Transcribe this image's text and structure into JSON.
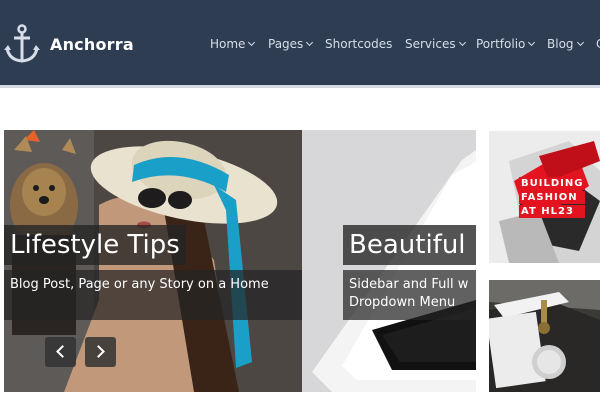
{
  "header": {
    "brand": "Anchorra",
    "logo_icon": "anchor-icon",
    "bg_color": "#2e3d52"
  },
  "nav": {
    "items": [
      {
        "label": "Home",
        "has_dropdown": true
      },
      {
        "label": "Pages",
        "has_dropdown": true
      },
      {
        "label": "Shortcodes",
        "has_dropdown": false
      },
      {
        "label": "Services",
        "has_dropdown": true
      },
      {
        "label": "Portfolio",
        "has_dropdown": true
      },
      {
        "label": "Blog",
        "has_dropdown": true
      },
      {
        "label": "C",
        "has_dropdown": false
      }
    ]
  },
  "slider": {
    "slides": [
      {
        "title": "Lifestyle Tips",
        "subtitle": "Blog Post, Page or any Story on a Home"
      },
      {
        "title": "Beautiful",
        "subtitle": "Sidebar and Full w Dropdown Menu"
      }
    ],
    "prev_icon": "chevron-left-icon",
    "next_icon": "chevron-right-icon"
  },
  "thumbnails": {
    "fashion_lines": [
      "BUILDING",
      "FASHION",
      "AT HL23"
    ],
    "accent_color": "#e31420"
  }
}
